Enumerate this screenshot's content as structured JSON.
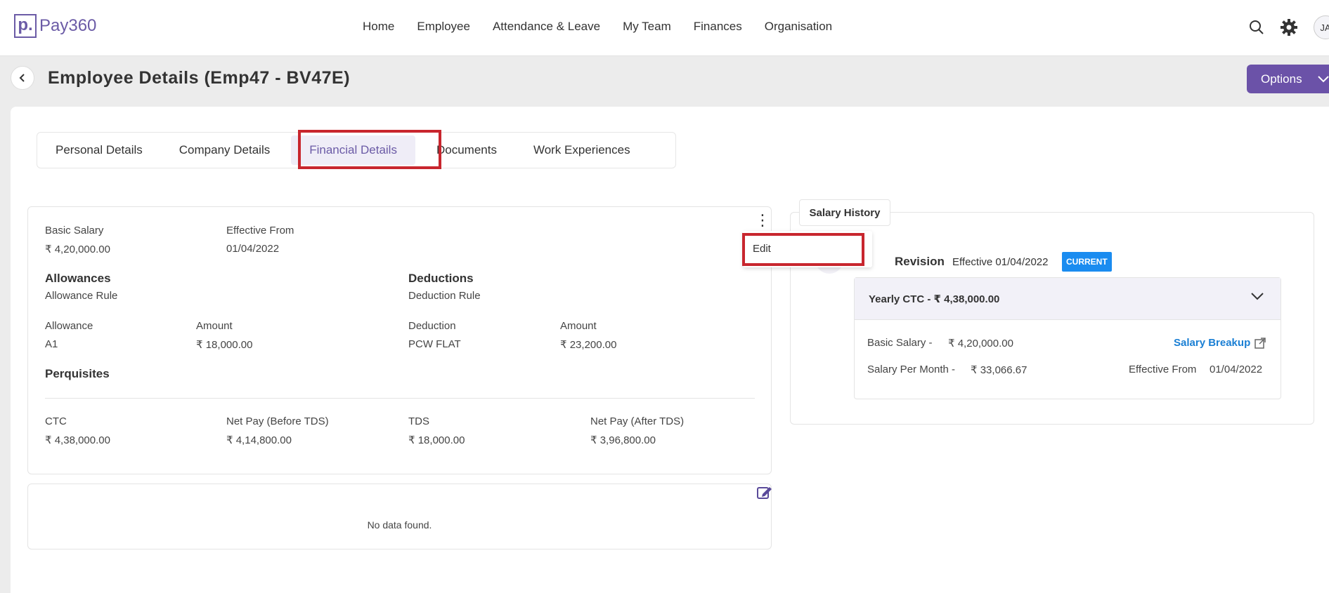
{
  "brand": {
    "logo_letter": "p.",
    "name": "Pay360"
  },
  "nav": {
    "items": [
      "Home",
      "Employee",
      "Attendance & Leave",
      "My Team",
      "Finances",
      "Organisation"
    ]
  },
  "user": {
    "initials": "JA"
  },
  "header": {
    "title": "Employee Details (Emp47 - BV47E)",
    "options_label": "Options"
  },
  "tabs": [
    "Personal Details",
    "Company Details",
    "Financial Details",
    "Documents",
    "Work Experiences"
  ],
  "active_tab": "Financial Details",
  "financial": {
    "basic_salary_label": "Basic Salary",
    "basic_salary_value": "₹ 4,20,000.00",
    "effective_from_label": "Effective From",
    "effective_from_value": "01/04/2022",
    "allowances_title": "Allowances",
    "allowance_rule_label": "Allowance Rule",
    "allowance_col": "Allowance",
    "allowance_amount_col": "Amount",
    "allowance_name": "A1",
    "allowance_amount": "₹ 18,000.00",
    "deductions_title": "Deductions",
    "deduction_rule_label": "Deduction Rule",
    "deduction_col": "Deduction",
    "deduction_amount_col": "Amount",
    "deduction_name": "PCW FLAT",
    "deduction_amount": "₹ 23,200.00",
    "perquisites_title": "Perquisites",
    "ctc_label": "CTC",
    "ctc_value": "₹ 4,38,000.00",
    "net_before_label": "Net Pay (Before TDS)",
    "net_before_value": "₹ 4,14,800.00",
    "tds_label": "TDS",
    "tds_value": "₹ 18,000.00",
    "net_after_label": "Net Pay (After TDS)",
    "net_after_value": "₹ 3,96,800.00"
  },
  "menu": {
    "edit_label": "Edit"
  },
  "nodata": {
    "text": "No data found."
  },
  "history": {
    "tab_label": "Salary History",
    "revision_title": "Revision",
    "revision_effective": "Effective 01/04/2022",
    "badge": "CURRENT",
    "yearly_ctc": "Yearly CTC - ₹ 4,38,000.00",
    "basic_label": "Basic Salary -",
    "basic_value": "₹ 4,20,000.00",
    "per_month_label": "Salary Per Month -",
    "per_month_value": "₹ 33,066.67",
    "breakup_link": "Salary Breakup",
    "effective_label": "Effective From",
    "effective_value": "01/04/2022"
  },
  "colors": {
    "brand": "#6b5ba6",
    "options_bg": "#6b52a8",
    "highlight": "#c8262e",
    "badge": "#1a8cf0",
    "link": "#1a7fd4"
  }
}
